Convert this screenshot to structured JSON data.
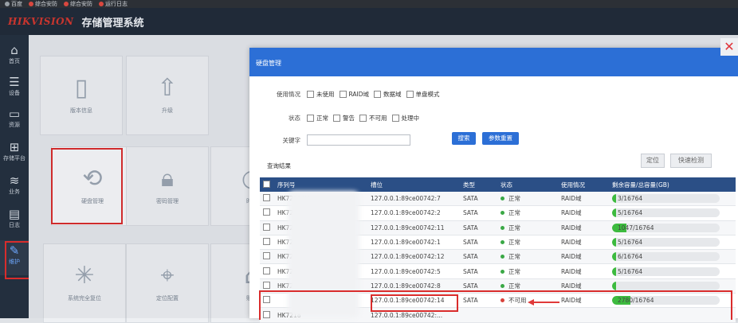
{
  "bookmarks": [
    {
      "label": "百度",
      "icon": "page-icon"
    },
    {
      "label": "综合安防",
      "icon": "red-circle-icon"
    },
    {
      "label": "综合安防",
      "icon": "red-circle-icon"
    },
    {
      "label": "运行日志",
      "icon": "red-circle-icon"
    }
  ],
  "app": {
    "logo": "HIKVISION",
    "title": "存储管理系统"
  },
  "sidebar": {
    "items": [
      {
        "label": "首页",
        "icon": "home-icon"
      },
      {
        "label": "设备",
        "icon": "server-icon"
      },
      {
        "label": "资源",
        "icon": "folder-icon"
      },
      {
        "label": "存储平台",
        "icon": "grid-icon"
      },
      {
        "label": "业务",
        "icon": "stack-icon"
      },
      {
        "label": "日志",
        "icon": "log-icon"
      },
      {
        "label": "维护",
        "icon": "wrench-icon"
      }
    ]
  },
  "tiles": [
    {
      "label": "版本信息",
      "icon": "document-icon"
    },
    {
      "label": "升级",
      "icon": "upload-icon"
    },
    {
      "label": "硬盘管理",
      "icon": "disk-icon"
    },
    {
      "label": "密码管理",
      "icon": "lock-icon"
    },
    {
      "label": "时间",
      "icon": "clock-icon"
    },
    {
      "label": "系统完全复位",
      "icon": "reset-icon"
    },
    {
      "label": "定位配置",
      "icon": "location-icon"
    },
    {
      "label": "账号",
      "icon": "user-icon"
    }
  ],
  "modal": {
    "title": "硬盘管理",
    "filters": {
      "usage_label": "使用情况",
      "usage_options": [
        "未使用",
        "RAID域",
        "数据域",
        "单盘模式"
      ],
      "status_label": "状态",
      "status_options": [
        "正常",
        "警告",
        "不可用",
        "处理中"
      ],
      "keyword_label": "关键字",
      "keyword_value": "",
      "search_button": "搜索",
      "reset_button": "参数重置"
    },
    "results_label": "查询结果",
    "locate_button": "定位",
    "quick_check_button": "快速检测",
    "table": {
      "headers": [
        "",
        "序列号",
        "槽位",
        "类型",
        "状态",
        "使用情况",
        "剩余容量/总容量(GB)"
      ],
      "rows": [
        {
          "serial": "HK7218AH",
          "slot": "127.0.0.1:89ce00742:7",
          "type": "SATA",
          "status": "正常",
          "status_ok": true,
          "usage": "RAID域",
          "capacity": "3/16764",
          "fill": 0.04
        },
        {
          "serial": "HK7218AH.ZL2C",
          "slot": "127.0.0.1:89ce00742:2",
          "type": "SATA",
          "status": "正常",
          "status_ok": true,
          "usage": "RAID域",
          "capacity": "5/16764",
          "fill": 0.04
        },
        {
          "serial": "HK72",
          "slot": "127.0.0.1:89ce00742:11",
          "type": "SATA",
          "status": "正常",
          "status_ok": true,
          "usage": "RAID域",
          "capacity": "1047/16764",
          "fill": 0.13
        },
        {
          "serial": "HK72",
          "slot": "127.0.0.1:89ce00742:1",
          "type": "SATA",
          "status": "正常",
          "status_ok": true,
          "usage": "RAID域",
          "capacity": "5/16764",
          "fill": 0.04
        },
        {
          "serial": "HK72",
          "slot": "127.0.0.1:89ce00742:12",
          "type": "SATA",
          "status": "正常",
          "status_ok": true,
          "usage": "RAID域",
          "capacity": "6/16764",
          "fill": 0.04
        },
        {
          "serial": "HK7218AH",
          "slot": "127.0.0.1:89ce00742:5",
          "type": "SATA",
          "status": "正常",
          "status_ok": true,
          "usage": "RAID域",
          "capacity": "5/16764",
          "fill": 0.04
        },
        {
          "serial": "HK7218AH.ZL2B0",
          "slot": "127.0.0.1:89ce00742:8",
          "type": "SATA",
          "status": "正常",
          "status_ok": true,
          "usage": "RAID域",
          "capacity": "",
          "fill": 0.04
        },
        {
          "serial": "",
          "slot": "127.0.0.1:89ce00742:14",
          "type": "SATA",
          "status": "不可用",
          "status_ok": false,
          "usage": "RAID域",
          "capacity": "2780/16764",
          "fill": 0.17
        },
        {
          "serial": "HK7218",
          "slot": "127.0.0.1:89ce00742:...",
          "type": "",
          "status": "",
          "status_ok": true,
          "usage": "",
          "capacity": "",
          "fill": 0.0
        }
      ]
    }
  }
}
